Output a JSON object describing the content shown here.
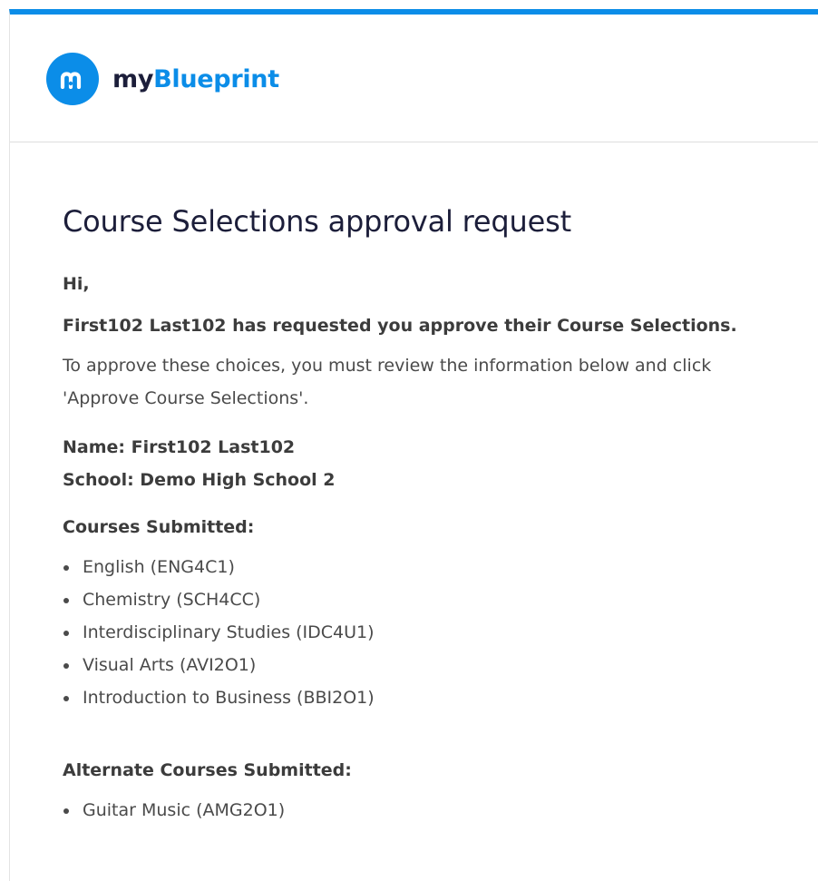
{
  "brand": {
    "name_prefix": "my",
    "name_suffix": "Blueprint",
    "accent_color": "#0b8de8",
    "dark_color": "#1c1e3a",
    "logo_icon": "myblueprint-m-logo-icon"
  },
  "email": {
    "title": "Course Selections approval request",
    "greeting": "Hi,",
    "request_line": "First102 Last102 has requested you approve their Course Selections.",
    "instructions": "To approve these choices, you must review the information below and click 'Approve Course Selections'.",
    "name_line": "Name: First102 Last102",
    "school_line": "School: Demo High School 2",
    "courses_heading": "Courses Submitted:",
    "courses": [
      "English (ENG4C1)",
      "Chemistry (SCH4CC)",
      "Interdisciplinary Studies (IDC4U1)",
      "Visual Arts (AVI2O1)",
      "Introduction to Business (BBI2O1)"
    ],
    "alternates_heading": "Alternate Courses Submitted:",
    "alternates": [
      "Guitar Music (AMG2O1)"
    ]
  }
}
